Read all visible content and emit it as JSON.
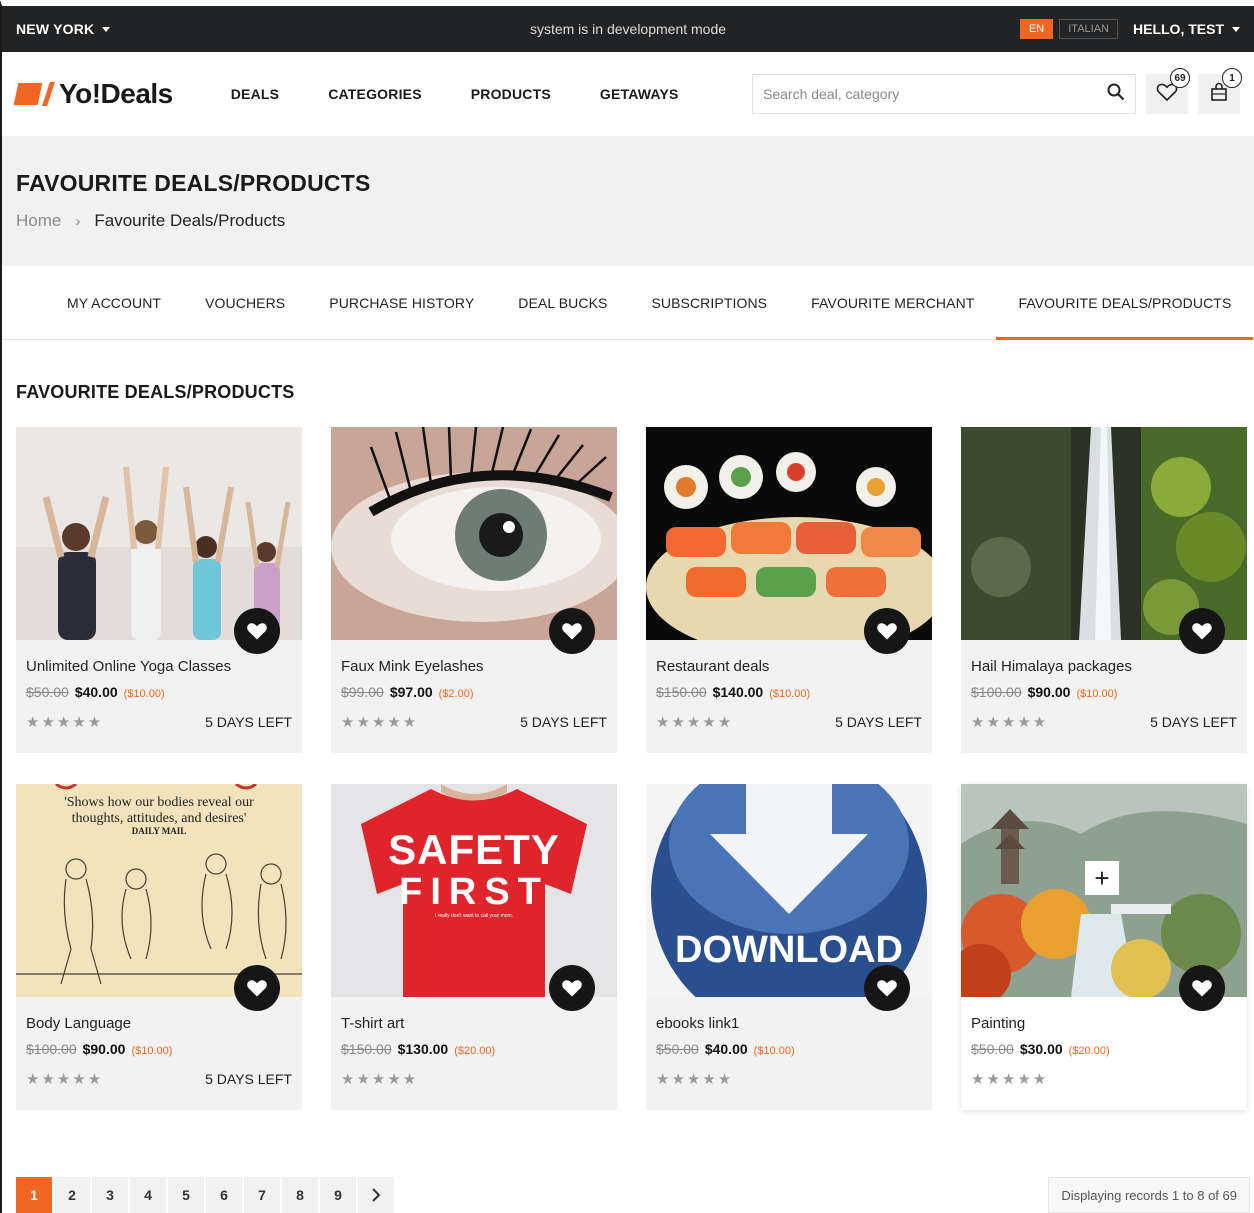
{
  "topbar": {
    "city": "NEW YORK",
    "dev_message": "system is in development mode",
    "lang_en": "EN",
    "lang_it": "ITALIAN",
    "greeting": "HELLO, TEST"
  },
  "header": {
    "logo_text": "Yo!Deals",
    "nav": [
      "DEALS",
      "CATEGORIES",
      "PRODUCTS",
      "GETAWAYS"
    ],
    "search_placeholder": "Search deal, category",
    "wishlist_count": "69",
    "cart_count": "1"
  },
  "banner": {
    "title": "FAVOURITE DEALS/PRODUCTS",
    "breadcrumb_home": "Home",
    "breadcrumb_current": "Favourite Deals/Products"
  },
  "tabs": [
    "MY ACCOUNT",
    "VOUCHERS",
    "PURCHASE HISTORY",
    "DEAL BUCKS",
    "SUBSCRIPTIONS",
    "FAVOURITE MERCHANT",
    "FAVOURITE DEALS/PRODUCTS"
  ],
  "section_title": "FAVOURITE DEALS/PRODUCTS",
  "cards": [
    {
      "title": "Unlimited Online Yoga Classes",
      "old": "$50.00",
      "new": "$40.00",
      "save": "($10.00)",
      "days": "5 DAYS LEFT"
    },
    {
      "title": "Faux Mink Eyelashes",
      "old": "$99.00",
      "new": "$97.00",
      "save": "($2.00)",
      "days": "5 DAYS LEFT"
    },
    {
      "title": "Restaurant deals",
      "old": "$150.00",
      "new": "$140.00",
      "save": "($10.00)",
      "days": "5 DAYS LEFT"
    },
    {
      "title": "Hail Himalaya packages",
      "old": "$100.00",
      "new": "$90.00",
      "save": "($10.00)",
      "days": "5 DAYS LEFT"
    },
    {
      "title": "Body Language",
      "old": "$100.00",
      "new": "$90.00",
      "save": "($10.00)",
      "days": "5 DAYS LEFT"
    },
    {
      "title": "T-shirt art",
      "old": "$150.00",
      "new": "$130.00",
      "save": "($20.00)",
      "days": ""
    },
    {
      "title": "ebooks link1",
      "old": "$50.00",
      "new": "$40.00",
      "save": "($10.00)",
      "days": ""
    },
    {
      "title": "Painting",
      "old": "$50.00",
      "new": "$30.00",
      "save": "($20.00)",
      "days": ""
    }
  ],
  "images": {
    "book_quote_1": "'Shows how our bodies reveal our",
    "book_quote_2": "thoughts, attitudes, and desires'",
    "book_source": "DAILY MAIL",
    "shirt_line1": "SAFETY",
    "shirt_line2": "FIRST",
    "shirt_small": "I really don't want to call your mom.",
    "download_label": "DOWNLOAD"
  },
  "pagination": {
    "pages": [
      "1",
      "2",
      "3",
      "4",
      "5",
      "6",
      "7",
      "8",
      "9"
    ],
    "records": "Displaying records 1 to 8 of 69"
  },
  "colors": {
    "accent": "#f26522",
    "topbar": "#222325"
  },
  "stars": "★★★★★"
}
